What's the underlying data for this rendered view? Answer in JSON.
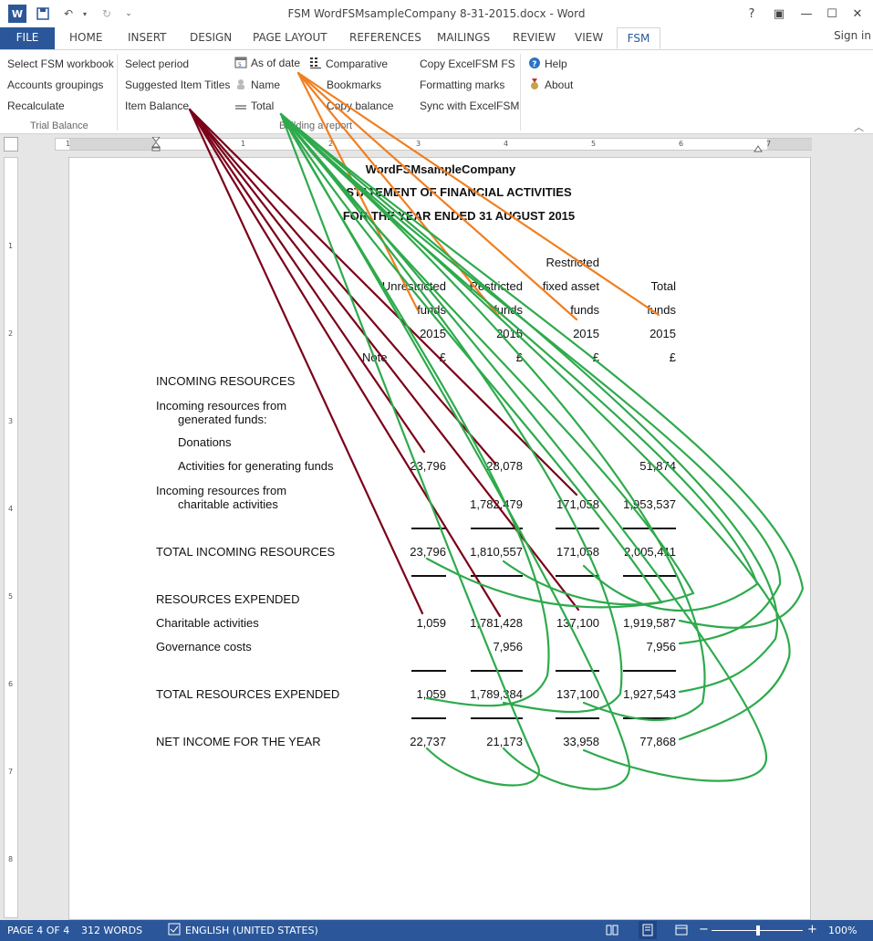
{
  "window": {
    "title": "FSM WordFSMsampleCompany 8-31-2015.docx - Word",
    "logo": "W",
    "controls": [
      "?",
      "▣",
      "—",
      "☐",
      "✕"
    ]
  },
  "tabs": [
    "FILE",
    "HOME",
    "INSERT",
    "DESIGN",
    "PAGE LAYOUT",
    "REFERENCES",
    "MAILINGS",
    "REVIEW",
    "VIEW",
    "FSM"
  ],
  "signin": "Sign in",
  "ribbon": {
    "trial_balance": {
      "label": "Trial Balance",
      "items": [
        "Select FSM workbook",
        "Accounts groupings",
        "Recalculate"
      ]
    },
    "building": {
      "label": "Building a report",
      "col1": [
        "Select period",
        "Suggested Item Titles",
        "Item Balance"
      ],
      "col2": [
        "As of date",
        "Name",
        "Total"
      ],
      "col3": [
        "Comparative",
        "Bookmarks",
        "Copy balance"
      ],
      "col4": [
        "Copy ExcelFSM FS",
        "Formatting marks",
        "Sync with ExcelFSM"
      ]
    },
    "help": {
      "items": [
        "Help",
        "About"
      ]
    }
  },
  "ruler": {
    "h": [
      "1",
      "1",
      "2",
      "3",
      "4",
      "5",
      "6",
      "7"
    ],
    "v": [
      "1",
      "2",
      "3",
      "4",
      "5",
      "6",
      "7",
      "8"
    ]
  },
  "document": {
    "company": "WordFSMsampleCompany",
    "heading1": "STATEMENT OF FINANCIAL ACTIVITIES",
    "heading2": "FOR THE YEAR ENDED 31 AUGUST 2015",
    "col_headers": {
      "restricted_top": "Restricted",
      "row2": [
        "Unrestricted",
        "Restricted",
        "fixed asset",
        "Total"
      ],
      "row3": [
        "funds",
        "funds",
        "funds",
        "funds"
      ],
      "row4": [
        "2015",
        "2015",
        "2015",
        "2015"
      ],
      "note": "Note",
      "currency": [
        "£",
        "£",
        "£",
        "£"
      ]
    },
    "incoming_heading": "INCOMING RESOURCES",
    "gen_funds_l1": "Incoming resources from",
    "gen_funds_l2": "generated funds:",
    "donations": "Donations",
    "activities": {
      "label": "Activities for generating funds",
      "values": [
        "23,796",
        "28,078",
        "",
        "51,874"
      ]
    },
    "charitable_l1": "Incoming resources from",
    "charitable_l2": "charitable activities",
    "charitable_values": [
      "",
      "1,782,479",
      "171,058",
      "1,953,537"
    ],
    "total_incoming": {
      "label": "TOTAL INCOMING RESOURCES",
      "values": [
        "23,796",
        "1,810,557",
        "171,058",
        "2,005,411"
      ]
    },
    "expended_heading": "RESOURCES EXPENDED",
    "charitable_act": {
      "label": "Charitable activities",
      "values": [
        "1,059",
        "1,781,428",
        "137,100",
        "1,919,587"
      ]
    },
    "governance": {
      "label": "Governance costs",
      "values": [
        "",
        "7,956",
        "",
        "7,956"
      ]
    },
    "total_expended": {
      "label": "TOTAL RESOURCES EXPENDED",
      "values": [
        "1,059",
        "1,789,384",
        "137,100",
        "1,927,543"
      ]
    },
    "net_income": {
      "label": "NET INCOME FOR THE YEAR",
      "values": [
        "22,737",
        "21,173",
        "33,958",
        "77,868"
      ]
    }
  },
  "status": {
    "page": "PAGE 4 OF 4",
    "words": "312 WORDS",
    "language": "ENGLISH (UNITED STATES)",
    "zoom": "100%"
  },
  "colors": {
    "word_blue": "#2b579a",
    "arrow_item_balance": "#7b0019",
    "arrow_as_of_date": "#f07f22",
    "arrow_total": "#2eaa4c"
  }
}
